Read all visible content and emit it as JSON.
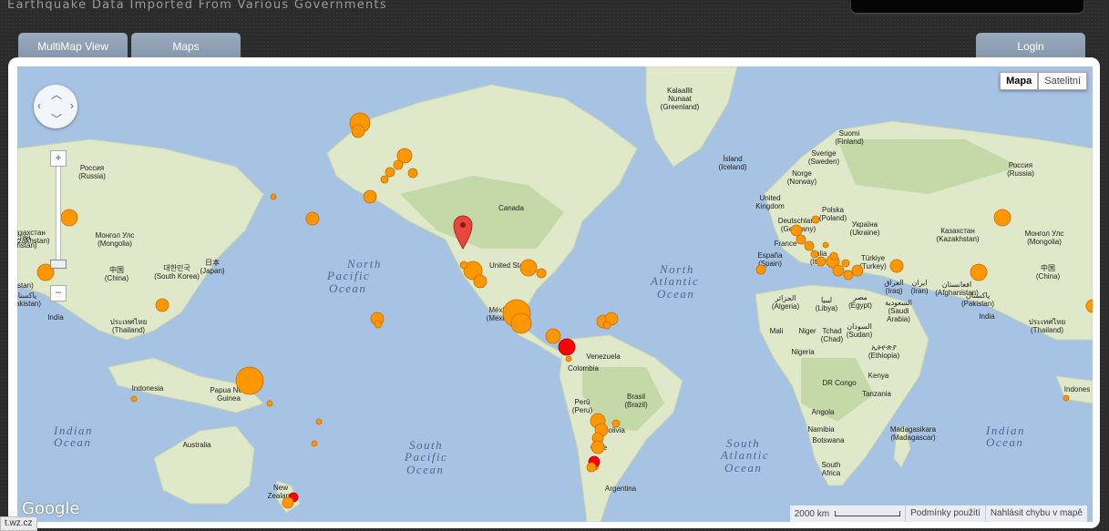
{
  "header": {
    "tagline": "Earthquake Data Imported From Various Governments"
  },
  "nav": {
    "multimap_label": "MultiMap View",
    "maps_label": "Maps",
    "login_label": "Login"
  },
  "map": {
    "type_map_label": "Mapa",
    "type_satellite_label": "Satelitní",
    "zoom_in": "+",
    "zoom_out": "−",
    "logo_text": "Google",
    "scale_label": "2000 km",
    "terms_label": "Podmínky použití",
    "report_label": "Nahlásit chybu v mapě",
    "colors": {
      "ocean": "#a6c3e3",
      "land": "#dfe8c8",
      "land_green": "#b9d39a",
      "quake_orange": "#ff9800",
      "quake_red": "#ff0000",
      "pin": "#e8463f"
    },
    "ocean_labels": [
      "North",
      "Pacific",
      "Ocean",
      "North",
      "Atlantic",
      "Ocean",
      "South",
      "Pacific",
      "Ocean",
      "South",
      "Atlantic",
      "Ocean",
      "Indian",
      "Ocean",
      "Indian",
      "Ocean"
    ],
    "place_labels": [
      "Kalaallit",
      "Nunaat",
      "(Greenland)",
      "Ísland",
      "(Iceland)",
      "Sverige",
      "(Sweden)",
      "Suomi",
      "(Finland)",
      "Norge",
      "(Norway)",
      "United",
      "Kingdom",
      "Polska",
      "(Poland)",
      "Україна",
      "(Ukraine)",
      "Deutschland",
      "(Germany)",
      "France",
      "Italia",
      "(Italy)",
      "España",
      "(Spain)",
      "Türkiye",
      "(Turkey)",
      "Россия",
      "(Russia)",
      "Казахстан",
      "(Kazakhstan)",
      "Монгол Улс",
      "(Mongolia)",
      "中国",
      "(China)",
      "대한민국",
      "(South Korea)",
      "日本",
      "(Japan)",
      "India",
      "ประเทศไทย",
      "(Thailand)",
      "Indonesia",
      "Papua New",
      "Guinea",
      "Australia",
      "New",
      "Zealand",
      "Canada",
      "United States",
      "México",
      "(Mexico)",
      "Venezuela",
      "Colombia",
      "Perú",
      "(Peru)",
      "Brasil",
      "(Brazil)",
      "Bolivia",
      "Chile",
      "Argentina",
      "الجزائر",
      "(Algeria)",
      "ليبيا",
      "(Libya)",
      "مصر",
      "(Egypt)",
      "Mali",
      "Niger",
      "Tchad",
      "(Chad)",
      "السودان",
      "(Sudan)",
      "Nigeria",
      "ኢትዮጵያ",
      "(Ethiopia)",
      "Kenya",
      "DR Congo",
      "Tanzania",
      "Angola",
      "Namibia",
      "Botswana",
      "South",
      "Africa",
      "Madagasikara",
      "(Madagascar)",
      "العراق",
      "(Iraq)",
      "ایران",
      "(Iran)",
      "السعودية",
      "(Saudi",
      "Arabia)",
      "افغانستان",
      "(Afghanistan)",
      "پاکستان",
      "(Pakistan)",
      "Казахстан",
      "(Kazakhstan)",
      "Монгол Улс",
      "(Mongolia)",
      "中国",
      "(China)",
      "India",
      "ประเทศไทย",
      "(Thailand)",
      "Indones",
      "Россия",
      "(Russia)",
      "азахстан",
      "(Kazakhstan)",
      "fghanistan)",
      "پاکستان",
      "(Pakistan)"
    ]
  },
  "status_url": "t.wz.cz"
}
